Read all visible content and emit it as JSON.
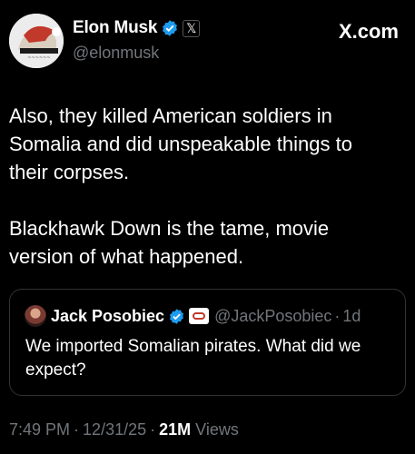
{
  "author": {
    "display_name": "Elon Musk",
    "handle": "@elonmusk",
    "verified_icon": "verified-badge-icon",
    "affiliate_icon": "x-logo-icon",
    "affiliate_glyph": "𝕏"
  },
  "brand": {
    "label": "X.com"
  },
  "post": {
    "text": "Also, they killed American soldiers in\nSomalia and did unspeakable things to\ntheir corpses.\n\nBlackhawk Down is the tame, movie\nversion of what happened."
  },
  "quoted_post": {
    "display_name": "Jack Posobiec",
    "handle": "@JackPosobiec",
    "separator": "·",
    "time": "1d",
    "text": "We imported Somalian pirates. What did we expect?"
  },
  "meta": {
    "time": "7:49 PM",
    "separator": "·",
    "date": "12/31/25",
    "views_count": "21M",
    "views_label": "Views"
  },
  "colors": {
    "background": "#000000",
    "text": "#ffffff",
    "secondary_text": "#71767b",
    "verified_blue": "#1d9bf0",
    "border": "#2f3336"
  }
}
